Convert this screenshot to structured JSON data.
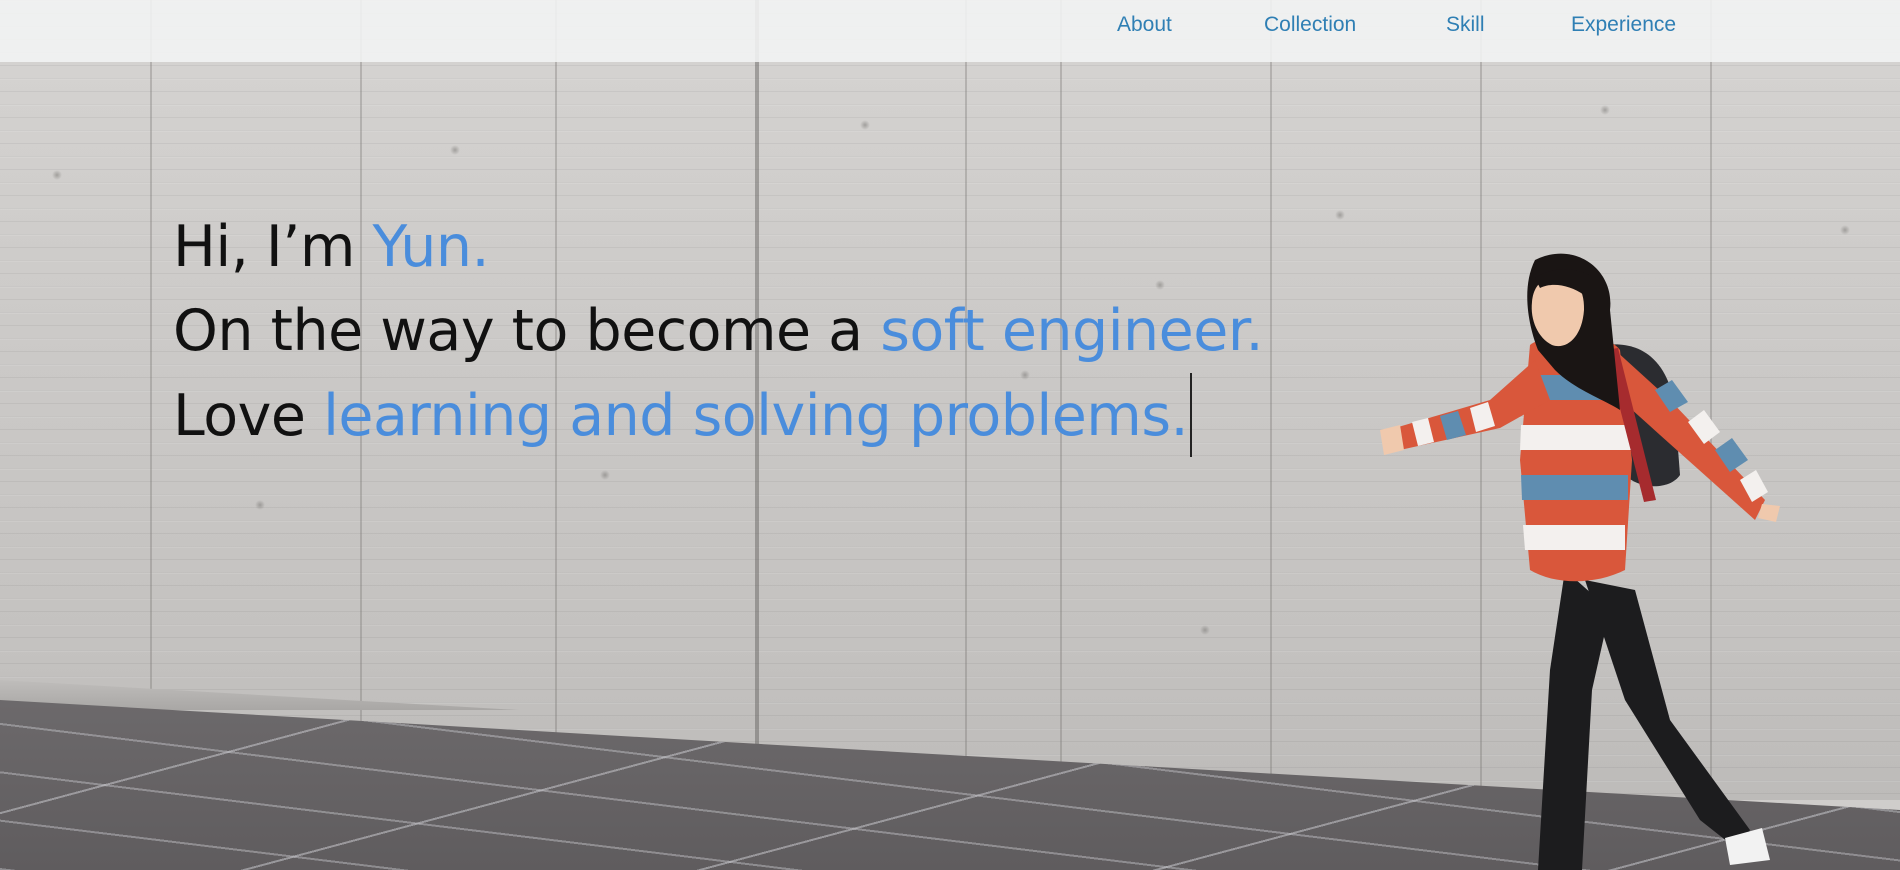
{
  "nav": {
    "links": [
      {
        "label": "About"
      },
      {
        "label": "Collection"
      },
      {
        "label": "Skill"
      },
      {
        "label": "Experience"
      }
    ]
  },
  "hero": {
    "line1": {
      "prefix": "Hi, I’m ",
      "highlight": "Yun."
    },
    "line2": {
      "prefix": "On the way to become a ",
      "highlight": "soft engineer."
    },
    "line3": {
      "prefix": "Love ",
      "highlight": "learning and solving problems."
    }
  },
  "colors": {
    "accent": "#4a8ddc",
    "nav_link": "#2f7fb4",
    "text": "#111111"
  },
  "icons": {
    "caret": "text-cursor-icon"
  }
}
